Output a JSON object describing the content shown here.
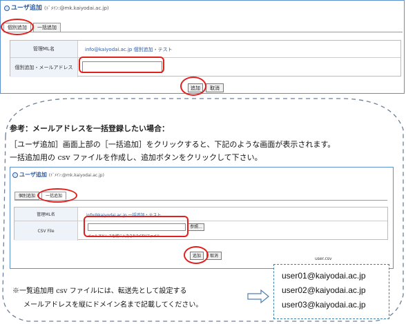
{
  "top_panel": {
    "title": "ユーザ追加",
    "subtitle": "(ﾄﾞﾒｲﾝ:@mk.kaiyodai.ac.jp)",
    "tabs": [
      "個別追加",
      "一括追加"
    ],
    "form": {
      "ml_label": "管理ML名",
      "ml_value": "info@kaiyodai.ac.jp 個別追加・テスト",
      "email_label": "個別追加・メールアドレス",
      "email_value": ""
    },
    "buttons": {
      "add": "追加",
      "cancel": "取消"
    }
  },
  "note": {
    "heading": "参考：メールアドレスを一括登録したい場合：",
    "line1": "［ユーザ追加］画面上部の［一括追加］をクリックすると、下記のような画面が表示されます。",
    "line2": "一括追加用の csv ファイルを作成し、追加ボタンをクリックして下さい。",
    "footnote1": "※一覧追加用 csv ファイルには、転送先として設定する",
    "footnote2": "メールアドレスを縦にドメイン名まで記載してください。"
  },
  "inner_panel": {
    "title": "ユーザ追加",
    "subtitle": "(ﾄﾞﾒｲﾝ:@mk.kaiyodai.ac.jp)",
    "tabs": [
      "個別追加",
      "一括追加"
    ],
    "form": {
      "ml_label": "管理ML名",
      "ml_value": "info@kaiyodai.ac.jp 一括追加・テスト",
      "csv_label": "CSV File",
      "browse": "参照...",
      "hint": "メールアドレスを縦に入力されたCSVファイル"
    },
    "buttons": {
      "add": "追加",
      "cancel": "取消"
    }
  },
  "csv_example": {
    "title": "user.csv",
    "lines": [
      "user01@kaiyodai.ac.jp",
      "user02@kaiyodai.ac.jp",
      "user03@kaiyodai.ac.jp"
    ]
  },
  "colors": {
    "highlight": "#e0201d",
    "panel_border": "#5b8fd0",
    "link": "#2c5aa0"
  }
}
